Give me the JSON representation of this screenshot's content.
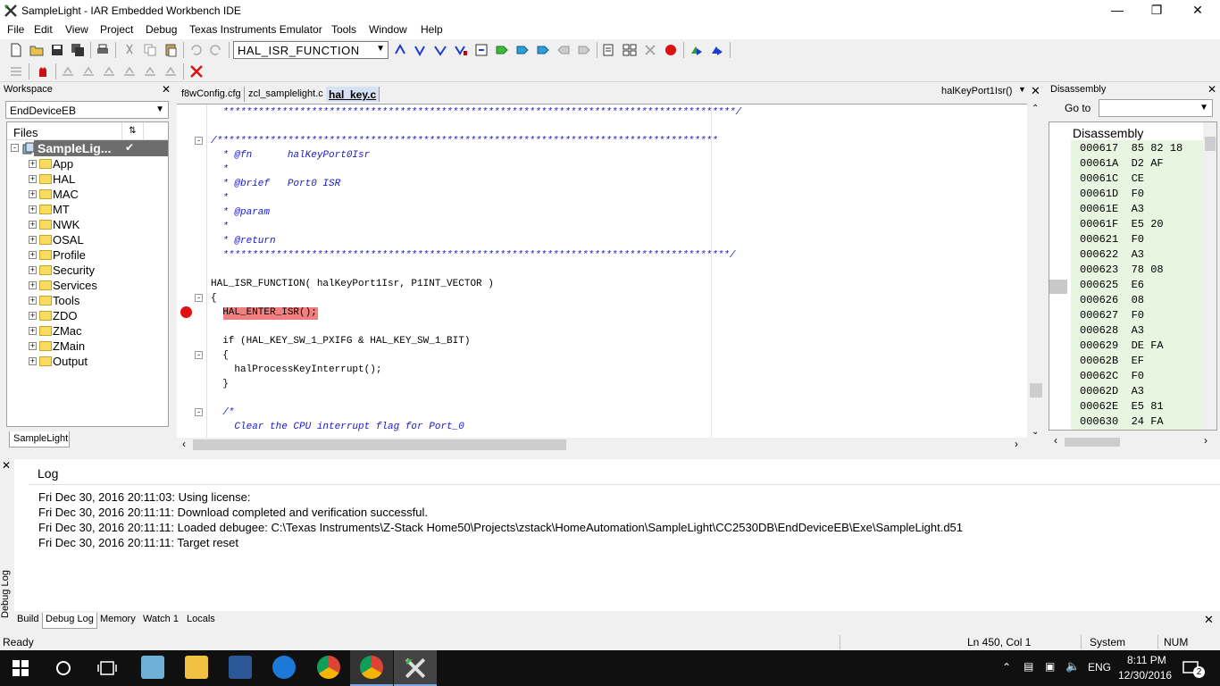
{
  "window": {
    "title": "SampleLight - IAR Embedded Workbench IDE"
  },
  "menu": [
    "File",
    "Edit",
    "View",
    "Project",
    "Debug",
    "Texas Instruments Emulator",
    "Tools",
    "Window",
    "Help"
  ],
  "toolbar": {
    "function_combo": "HAL_ISR_FUNCTION"
  },
  "workspace": {
    "title": "Workspace",
    "config": "EndDeviceEB",
    "files_header": "Files",
    "project": "SampleLig...",
    "groups": [
      "App",
      "HAL",
      "MAC",
      "MT",
      "NWK",
      "OSAL",
      "Profile",
      "Security",
      "Services",
      "Tools",
      "ZDO",
      "ZMac",
      "ZMain",
      "Output"
    ],
    "tab": "SampleLight"
  },
  "editor": {
    "tabs": [
      "f8wConfig.cfg",
      "zcl_samplelight.c",
      "hal_key.c"
    ],
    "active_tab": "hal_key.c",
    "function_nav": "halKeyPort1Isr()",
    "lines": [
      "  ***************************************************************************************/",
      "",
      "/*************************************************************************************",
      "  * @fn      halKeyPort0Isr",
      "  *",
      "  * @brief   Port0 ISR",
      "  *",
      "  * @param",
      "  *",
      "  * @return",
      "  **************************************************************************************/",
      "",
      "HAL_ISR_FUNCTION( halKeyPort1Isr, P1INT_VECTOR )",
      "{",
      "  HAL_ENTER_ISR();",
      "",
      "  if (HAL_KEY_SW_1_PXIFG & HAL_KEY_SW_1_BIT)",
      "  {",
      "    halProcessKeyInterrupt();",
      "  }",
      "",
      "  /*",
      "    Clear the CPU interrupt flag for Port_0"
    ]
  },
  "disassembly": {
    "title": "Disassembly",
    "goto_label": "Go to",
    "header": "Disassembly",
    "rows": [
      "000617  85 82 18",
      "00061A  D2 AF",
      "00061C  CE",
      "00061D  F0",
      "00061E  A3",
      "00061F  E5 20",
      "000621  F0",
      "000622  A3",
      "000623  78 08",
      "000625  E6",
      "000626  08",
      "000627  F0",
      "000628  A3",
      "000629  DE FA",
      "00062B  EF",
      "00062C  F0",
      "00062D  A3",
      "00062E  E5 81",
      "000630  24 FA"
    ]
  },
  "log": {
    "header": "Log",
    "side_label": "Debug Log",
    "lines": [
      "Fri Dec 30, 2016 20:11:03: Using license:",
      "Fri Dec 30, 2016 20:11:11: Download completed and verification successful.",
      "Fri Dec 30, 2016 20:11:11: Loaded debugee: C:\\Texas Instruments\\Z-Stack Home50\\Projects\\zstack\\HomeAutomation\\SampleLight\\CC2530DB\\EndDeviceEB\\Exe\\SampleLight.d51",
      "Fri Dec 30, 2016 20:11:11: Target reset"
    ],
    "tabs": [
      "Build",
      "Debug Log",
      "Memory",
      "Watch 1",
      "Locals"
    ]
  },
  "status": {
    "ready": "Ready",
    "position": "Ln 450, Col 1",
    "mode": "System",
    "num": "NUM"
  },
  "taskbar": {
    "time": "8:11 PM",
    "date": "12/30/2016",
    "lang": "ENG",
    "notif_count": "2"
  }
}
